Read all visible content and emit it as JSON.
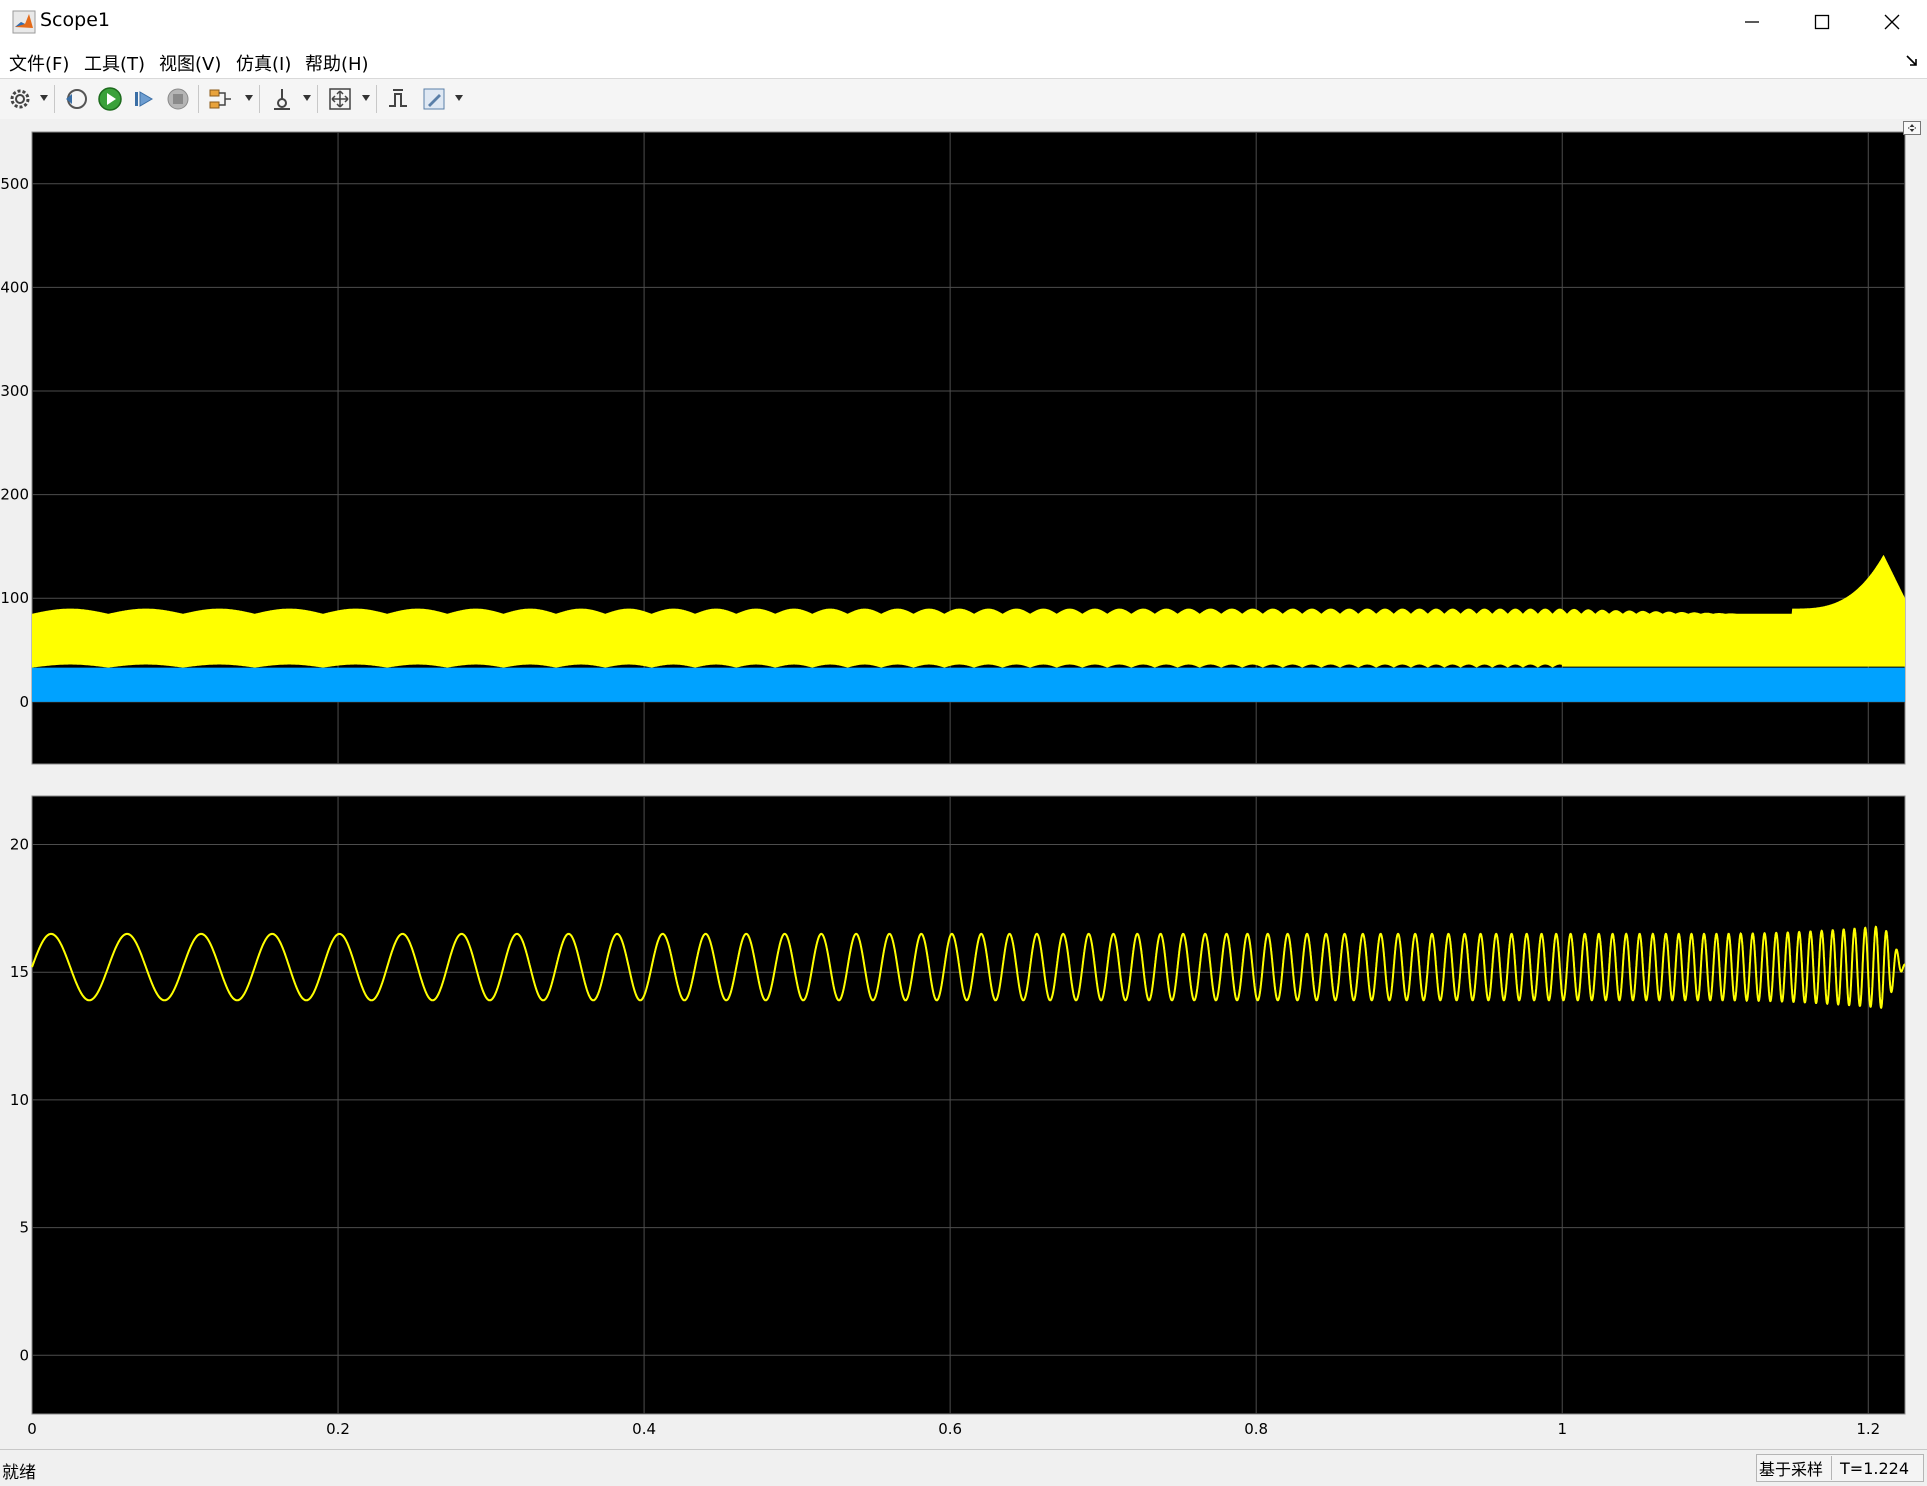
{
  "window": {
    "title": "Scope1"
  },
  "menu": {
    "items": [
      {
        "label": "文件(F)"
      },
      {
        "label": "工具(T)"
      },
      {
        "label": "视图(V)"
      },
      {
        "label": "仿真(I)"
      },
      {
        "label": "帮助(H)"
      }
    ]
  },
  "toolbar": {
    "icons": [
      "settings-icon",
      "step-back-icon",
      "run-icon",
      "step-forward-icon",
      "stop-icon",
      "signal-selector-icon",
      "trigger-icon",
      "zoom-axes-icon",
      "style-icon",
      "edit-icon"
    ]
  },
  "colors": {
    "plot_background": "#000000",
    "grid": "#4d4d4d",
    "signal_yellow": "#ffff00",
    "signal_blue": "#00a2ff",
    "axis_text": "#ffffff"
  },
  "chart_data": [
    {
      "type": "line",
      "xlim": [
        0,
        1.224
      ],
      "ylim": [
        -60,
        550
      ],
      "yticks": [
        "0",
        "100",
        "200",
        "300",
        "400",
        "500"
      ],
      "xticks": [],
      "grid": true,
      "series": [
        {
          "color": "#ffff00",
          "description": "oscillation band",
          "upper_start": 90,
          "upper_trough": 80,
          "lower": 33,
          "end_peak": 142,
          "end_value": 100
        },
        {
          "color": "#00a2ff",
          "description": "band",
          "upper": 33,
          "lower": 0
        }
      ]
    },
    {
      "type": "line",
      "xlim": [
        0,
        1.224
      ],
      "ylim": [
        -2.3,
        21.9
      ],
      "yticks": [
        "0",
        "5",
        "10",
        "15",
        "20"
      ],
      "xticks": [
        "0",
        "0.2",
        "0.4",
        "0.6",
        "0.8",
        "1",
        "1.2"
      ],
      "grid": true,
      "series": [
        {
          "color": "#ffff00",
          "center": 15.2,
          "amplitude": 1.3,
          "end_peak": 16.9,
          "end_trough": 13.7,
          "end_value": 15.3
        }
      ]
    }
  ],
  "status": {
    "left": "就绪",
    "mode": "基于采样",
    "time": "T=1.224"
  }
}
